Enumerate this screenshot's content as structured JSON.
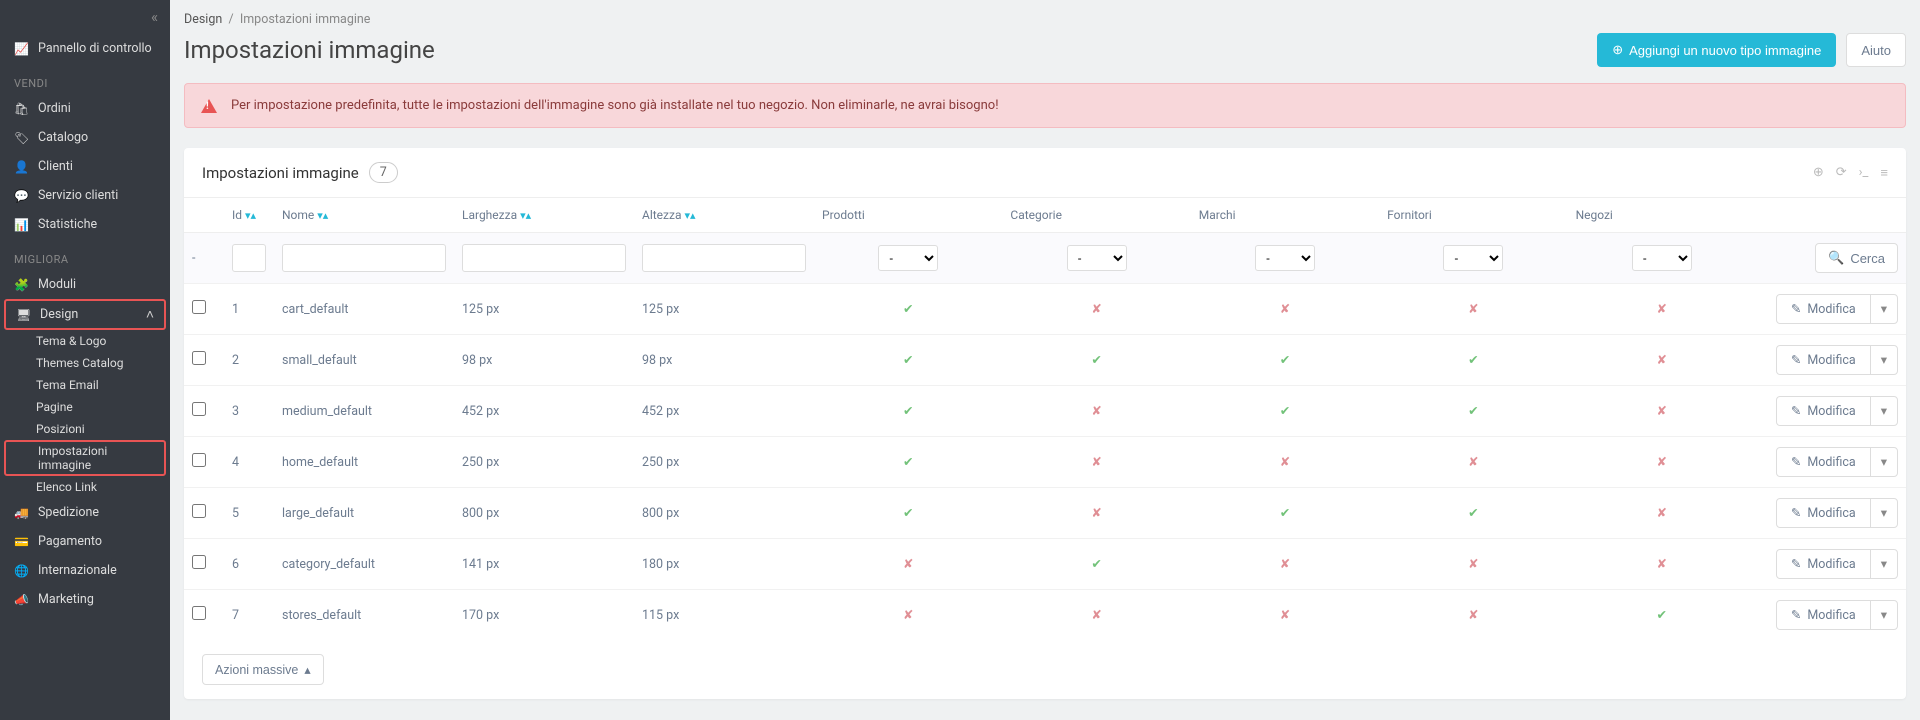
{
  "breadcrumb": {
    "root": "Design",
    "current": "Impostazioni immagine"
  },
  "page_title": "Impostazioni immagine",
  "actions": {
    "add_label": "Aggiungi un nuovo tipo immagine",
    "help_label": "Aiuto"
  },
  "alert_text": "Per impostazione predefinita, tutte le impostazioni dell'immagine sono già installate nel tuo negozio. Non eliminarle, ne avrai bisogno!",
  "card": {
    "title": "Impostazioni immagine",
    "count": "7",
    "search_label": "Cerca",
    "bulk_label": "Azioni massive",
    "edit_label": "Modifica",
    "headers": {
      "id": "Id",
      "name": "Nome",
      "width": "Larghezza",
      "height": "Altezza",
      "products": "Prodotti",
      "categories": "Categorie",
      "brands": "Marchi",
      "suppliers": "Fornitori",
      "stores": "Negozi"
    },
    "filter_dash": "-",
    "rows": [
      {
        "id": "1",
        "name": "cart_default",
        "w": "125 px",
        "h": "125 px",
        "p": true,
        "c": false,
        "b": false,
        "s": false,
        "st": false
      },
      {
        "id": "2",
        "name": "small_default",
        "w": "98 px",
        "h": "98 px",
        "p": true,
        "c": true,
        "b": true,
        "s": true,
        "st": false
      },
      {
        "id": "3",
        "name": "medium_default",
        "w": "452 px",
        "h": "452 px",
        "p": true,
        "c": false,
        "b": true,
        "s": true,
        "st": false
      },
      {
        "id": "4",
        "name": "home_default",
        "w": "250 px",
        "h": "250 px",
        "p": true,
        "c": false,
        "b": false,
        "s": false,
        "st": false
      },
      {
        "id": "5",
        "name": "large_default",
        "w": "800 px",
        "h": "800 px",
        "p": true,
        "c": false,
        "b": true,
        "s": true,
        "st": false
      },
      {
        "id": "6",
        "name": "category_default",
        "w": "141 px",
        "h": "180 px",
        "p": false,
        "c": true,
        "b": false,
        "s": false,
        "st": false
      },
      {
        "id": "7",
        "name": "stores_default",
        "w": "170 px",
        "h": "115 px",
        "p": false,
        "c": false,
        "b": false,
        "s": false,
        "st": true
      }
    ]
  },
  "sidebar": {
    "dashboard": "Pannello di controllo",
    "sell": "VENDI",
    "sell_items": [
      "Ordini",
      "Catalogo",
      "Clienti",
      "Servizio clienti",
      "Statistiche"
    ],
    "improve": "MIGLIORA",
    "modules": "Moduli",
    "design": "Design",
    "design_sub": [
      "Tema & Logo",
      "Themes Catalog",
      "Tema Email",
      "Pagine",
      "Posizioni",
      "Impostazioni immagine",
      "Elenco Link"
    ],
    "shipping": "Spedizione",
    "payment": "Pagamento",
    "international": "Internazionale",
    "marketing": "Marketing"
  }
}
